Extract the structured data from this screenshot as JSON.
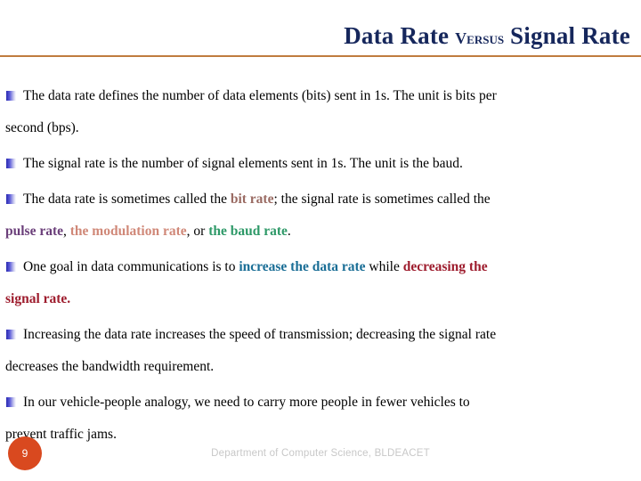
{
  "slide": {
    "title": {
      "part1": "Data Rate ",
      "small": "Versus",
      "part2": " Signal Rate"
    },
    "bullets": [
      {
        "lines": [
          "The data rate defines the number of data elements (bits) sent in 1s. The unit is bits per",
          "second (bps)."
        ]
      },
      {
        "lines": [
          "The signal rate is the number of signal elements sent in 1s. The unit is the baud."
        ]
      },
      {
        "rich": true,
        "segments_line1": [
          {
            "text": "The data rate is sometimes called the ",
            "style": "plain"
          },
          {
            "text": "bit rate",
            "style": "bitrate"
          },
          {
            "text": "; the signal rate is sometimes called the",
            "style": "plain"
          }
        ],
        "segments_line2": [
          {
            "text": "pulse rate",
            "style": "pulserate"
          },
          {
            "text": ", ",
            "style": "plain"
          },
          {
            "text": "the modulation rate",
            "style": "modulation"
          },
          {
            "text": ", or ",
            "style": "plain"
          },
          {
            "text": "the baud rate",
            "style": "baudrate"
          },
          {
            "text": ".",
            "style": "plain"
          }
        ]
      },
      {
        "rich": true,
        "segments_line1": [
          {
            "text": "One goal in data communications is to ",
            "style": "plain"
          },
          {
            "text": "increase the data rate",
            "style": "increase"
          },
          {
            "text": " while ",
            "style": "plain"
          },
          {
            "text": "decreasing the",
            "style": "decreasing"
          }
        ],
        "segments_line2": [
          {
            "text": "signal rate.",
            "style": "decreasing"
          }
        ]
      },
      {
        "lines": [
          "Increasing the data rate increases the speed of transmission; decreasing the signal rate",
          "decreases the bandwidth requirement."
        ]
      },
      {
        "lines": [
          "In our vehicle-people analogy, we need to carry more people in fewer vehicles to",
          "prevent traffic jams."
        ]
      }
    ],
    "footer": {
      "page_number": "9",
      "credit": "Department of Computer Science, BLDEACET"
    },
    "colors": {
      "title": "#16275c",
      "rule": "#b5651d",
      "bit_rate": "#9a6b63",
      "pulse_rate": "#6b3f7a",
      "modulation_rate": "#d08878",
      "baud_rate": "#2e9968",
      "increase_data_rate": "#1a6e96",
      "decreasing_signal_rate": "#9e1d2e",
      "page_badge": "#d9491f",
      "footer_text": "#c8c8c8"
    }
  }
}
